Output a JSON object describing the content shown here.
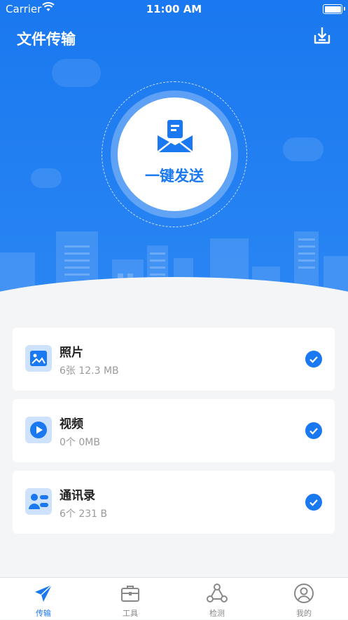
{
  "status_bar": {
    "carrier": "Carrier",
    "time": "11:00 AM"
  },
  "header": {
    "title": "文件传输"
  },
  "send": {
    "label": "一键发送"
  },
  "items": [
    {
      "title": "照片",
      "subtitle": "6张 12.3 MB",
      "checked": true,
      "icon": "image-icon"
    },
    {
      "title": "视频",
      "subtitle": "0个 0MB",
      "checked": true,
      "icon": "video-play-icon"
    },
    {
      "title": "通讯录",
      "subtitle": "6个 231 B",
      "checked": true,
      "icon": "contacts-icon"
    }
  ],
  "tabs": [
    {
      "label": "传输",
      "active": true,
      "icon": "paper-plane-icon"
    },
    {
      "label": "工具",
      "active": false,
      "icon": "toolbox-icon"
    },
    {
      "label": "检测",
      "active": false,
      "icon": "nodes-icon"
    },
    {
      "label": "我的",
      "active": false,
      "icon": "user-icon"
    }
  ],
  "colors": {
    "primary": "#1a78f0",
    "background": "#f4f5f7",
    "text": "#222222",
    "subtext": "#9a9a9a"
  }
}
